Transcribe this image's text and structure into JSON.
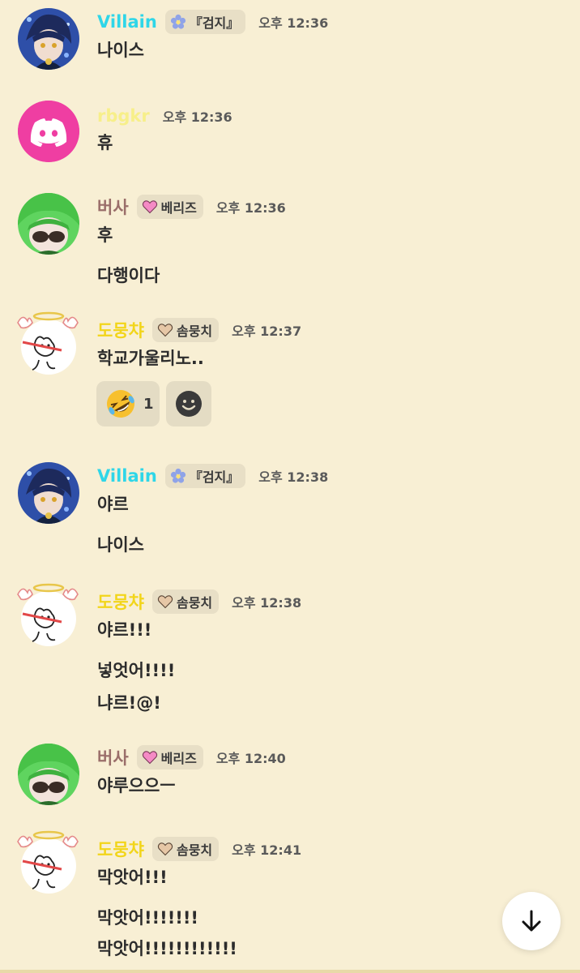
{
  "colors": {
    "background": "#f8efd4",
    "villain": "#2fd6e8",
    "rbgkr": "#f7ef8a",
    "bersa": "#9a6e6a",
    "dodungcha": "#f2d51a",
    "discord_bg": "#ef3ea2"
  },
  "groups": [
    {
      "user": "Villain",
      "role_icon": "blue-flower-icon",
      "role": "『검지』",
      "time": "오후 12:36",
      "lines": [
        "나이스"
      ]
    },
    {
      "user": "rbgkr",
      "time": "오후 12:36",
      "lines": [
        "휴"
      ]
    },
    {
      "user": "버사",
      "role_icon": "pink-heart-icon",
      "role": "베리즈",
      "time": "오후 12:36",
      "lines": [
        "후",
        "다행이다"
      ]
    },
    {
      "user": "도뭉챠",
      "role_icon": "beige-heart-icon",
      "role": "솜뭉치",
      "time": "오후 12:37",
      "lines": [
        "학교가울리노.."
      ],
      "reaction": {
        "emoji": "rolling-laughing-emoji",
        "count": "1"
      }
    },
    {
      "user": "Villain",
      "role_icon": "blue-flower-icon",
      "role": "『검지』",
      "time": "오후 12:38",
      "lines": [
        "야르",
        "나이스"
      ]
    },
    {
      "user": "도뭉챠",
      "role_icon": "beige-heart-icon",
      "role": "솜뭉치",
      "time": "오후 12:38",
      "lines": [
        "야르!!!",
        "넣엇어!!!!",
        "냐르!@!"
      ]
    },
    {
      "user": "버사",
      "role_icon": "pink-heart-icon",
      "role": "베리즈",
      "time": "오후 12:40",
      "lines": [
        "야루으으ㅡ"
      ]
    },
    {
      "user": "도뭉챠",
      "role_icon": "beige-heart-icon",
      "role": "솜뭉치",
      "time": "오후 12:41",
      "lines": [
        "막앗어!!!",
        "막앗어!!!!!!!",
        "막앗어!!!!!!!!!!!!"
      ]
    }
  ],
  "scroll_button_icon": "arrow-down-icon"
}
